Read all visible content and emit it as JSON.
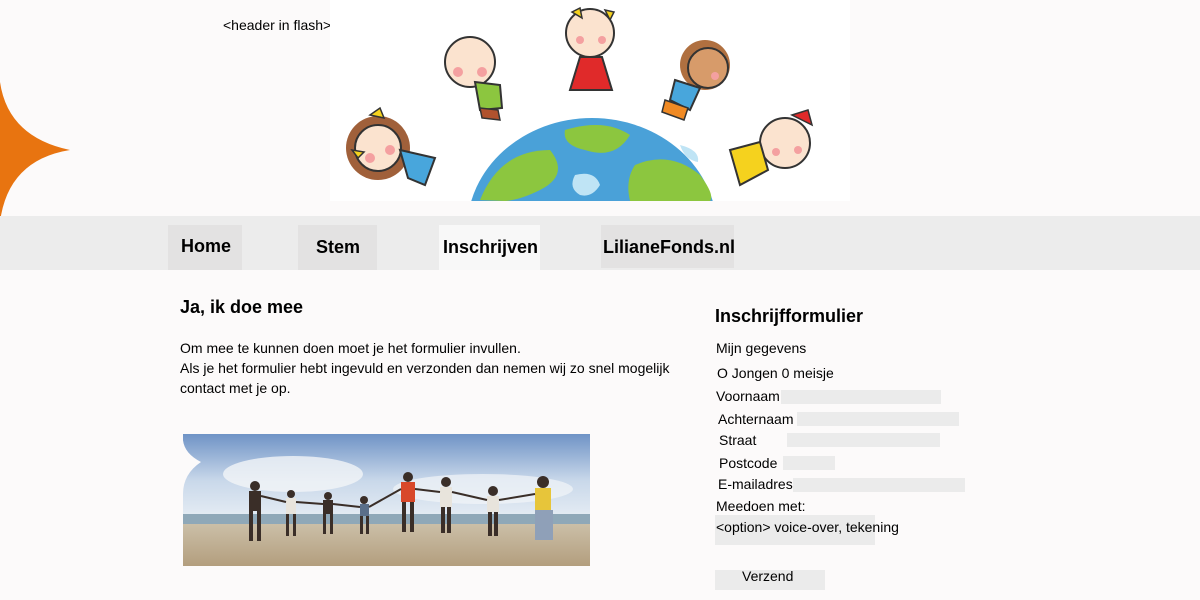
{
  "header": {
    "flash_label": "<header in flash>"
  },
  "nav": {
    "items": [
      {
        "label": "Home"
      },
      {
        "label": "Stem"
      },
      {
        "label": "Inschrijven"
      },
      {
        "label": "LilianeFonds.nl"
      }
    ],
    "active_index": 2
  },
  "main": {
    "title": "Ja, ik doe mee",
    "intro_lines": [
      "Om mee te kunnen doen moet je het formulier invullen.",
      "Als je het formulier hebt ingevuld en verzonden dan nemen wij zo snel mogelijk",
      "contact met je op."
    ]
  },
  "form": {
    "title": "Inschrijfformulier",
    "section_label": "Mijn gegevens",
    "gender_label": "O Jongen 0 meisje",
    "fields": [
      {
        "label": "Voornaam",
        "value": ""
      },
      {
        "label": "Achternaam",
        "value": ""
      },
      {
        "label": "Straat",
        "value": ""
      },
      {
        "label": "Postcode",
        "value": ""
      },
      {
        "label": "E-mailadres",
        "value": ""
      }
    ],
    "participate_label": "Meedoen met:",
    "option_text": "<option> voice-over, tekening",
    "submit_label": "Verzend"
  },
  "colors": {
    "nav_bar": "#ececec",
    "nav_tab": "#e3e2e2",
    "nav_tab_active": "#f8f8f8",
    "field_bg": "#ebebeb",
    "accent_star": "#e87410"
  }
}
